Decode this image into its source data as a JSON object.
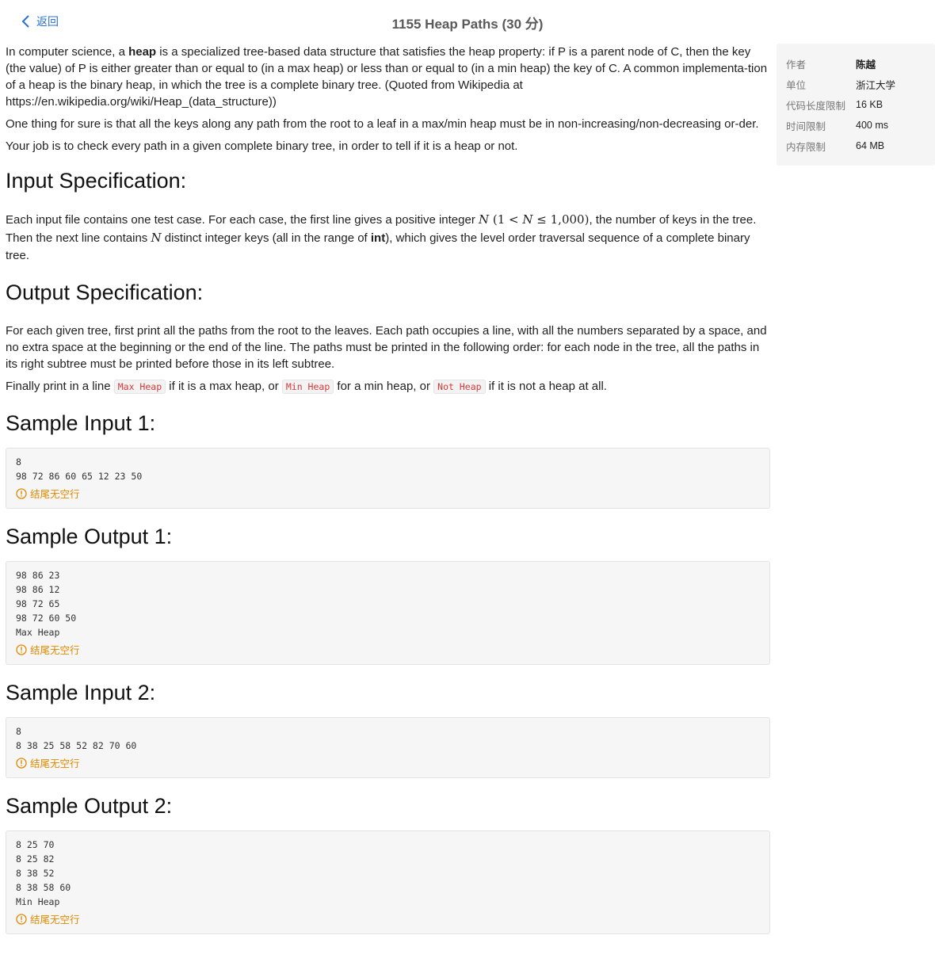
{
  "header": {
    "back_label": "返回",
    "title": "1155 Heap Paths (30 分)"
  },
  "description": {
    "p1_a": "In computer science, a ",
    "p1_bold": "heap",
    "p1_b": " is a specialized tree-based data structure that satisfies the heap property: if P is a parent node of C, then the key (the value) of P is either greater than or equal to (in a max heap) or less than or equal to (in a min heap) the key of C. A common implementa-tion of a heap is the binary heap, in which the tree is a complete binary tree. (Quoted from Wikipedia at https://en.wikipedia.org/wiki/Heap_(data_structure))",
    "p2": "One thing for sure is that all the keys along any path from the root to a leaf in a max/min heap must be in non-increasing/non-decreasing or-der.",
    "p3": "Your job is to check every path in a given complete binary tree, in order to tell if it is a heap or not."
  },
  "input_spec": {
    "heading": "Input Specification:",
    "t1": "Each input file contains one test case. For each case, the first line gives a positive integer ",
    "n": "N",
    "range_open": " (1 < ",
    "range_n": "N",
    "range_close": " ≤ 1,000)",
    "t2": ", the number of keys in the tree. Then the next line contains ",
    "n2": "N",
    "t3": " distinct integer keys (all in the range of ",
    "bold": "int",
    "t4": "), which gives the level order traversal sequence of a complete binary tree."
  },
  "output_spec": {
    "heading": "Output Specification:",
    "p1": "For each given tree, first print all the paths from the root to the leaves. Each path occupies a line, with all the numbers separated by a space, and no extra space at the beginning or the end of the line. The paths must be printed in the following order: for each node in the tree, all the paths in its right subtree must be printed before those in its left subtree.",
    "p2_a": "Finally print in a line ",
    "code1": "Max Heap",
    "p2_b": " if it is a max heap, or ",
    "code2": "Min Heap",
    "p2_c": " for a min heap, or ",
    "code3": "Not Heap",
    "p2_d": " if it is not a heap at all."
  },
  "samples": [
    {
      "heading": "Sample Input 1:",
      "code": "8\n98 72 86 60 65 12 23 50",
      "note": "结尾无空行"
    },
    {
      "heading": "Sample Output 1:",
      "code": "98 86 23\n98 86 12\n98 72 65\n98 72 60 50\nMax Heap",
      "note": "结尾无空行"
    },
    {
      "heading": "Sample Input 2:",
      "code": "8\n8 38 25 58 52 82 70 60",
      "note": "结尾无空行"
    },
    {
      "heading": "Sample Output 2:",
      "code": "8 25 70\n8 25 82\n8 38 52\n8 38 58 60\nMin Heap",
      "note": "结尾无空行"
    }
  ],
  "info": {
    "author_label": "作者",
    "author": "陈越",
    "org_label": "单位",
    "org": "浙江大学",
    "code_limit_label": "代码长度限制",
    "code_limit": "16 KB",
    "time_limit_label": "时间限制",
    "time_limit": "400 ms",
    "mem_limit_label": "内存限制",
    "mem_limit": "64 MB"
  },
  "colors": {
    "accent": "#2b6fd6",
    "warning": "#e08a00",
    "code_inline": "#d63a3a"
  },
  "icons": {
    "back": "chevron-left-icon",
    "warning": "exclamation-circle-icon"
  }
}
